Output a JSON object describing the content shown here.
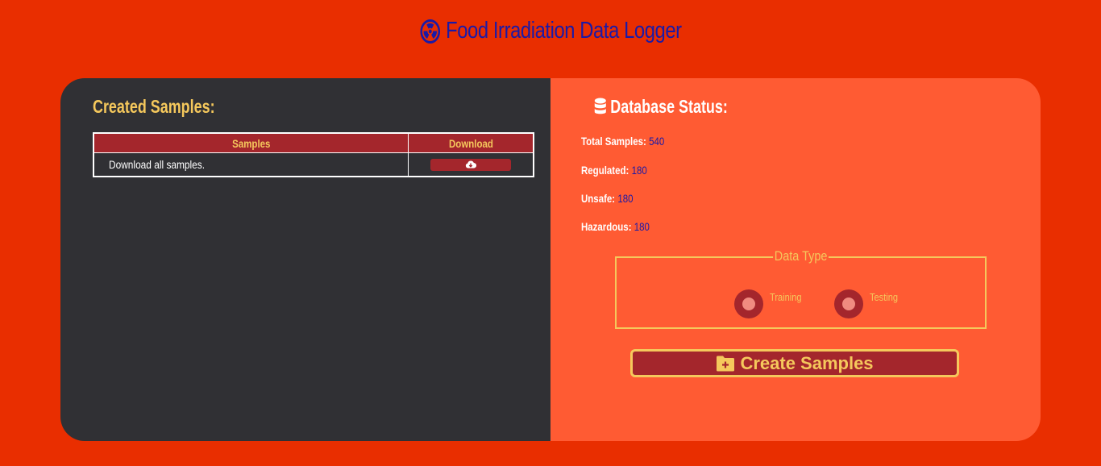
{
  "header": {
    "title": "Food Irradiation Data Logger",
    "icon": "radiation-icon"
  },
  "samples_panel": {
    "heading": "Created Samples:",
    "table": {
      "columns": [
        "Samples",
        "Download"
      ],
      "rows": [
        {
          "label": "Download all samples.",
          "action_icon": "cloud-download-icon"
        }
      ]
    }
  },
  "status_panel": {
    "heading": "Database Status:",
    "icon": "database-icon",
    "stats": [
      {
        "label": "Total Samples:",
        "value": "540"
      },
      {
        "label": "Regulated:",
        "value": "180"
      },
      {
        "label": "Unsafe:",
        "value": "180"
      },
      {
        "label": "Hazardous:",
        "value": "180"
      }
    ],
    "data_type": {
      "legend": "Data Type",
      "options": [
        "Training",
        "Testing"
      ]
    },
    "create_button": {
      "label": "Create Samples",
      "icon": "folder-plus-icon"
    }
  },
  "colors": {
    "page_bg": "#e92e00",
    "left_panel_bg": "#303034",
    "right_panel_bg": "#ff5b33",
    "accent_gold": "#f5c85c",
    "accent_red": "#a4262c",
    "value_blue": "#1a1aa8"
  }
}
